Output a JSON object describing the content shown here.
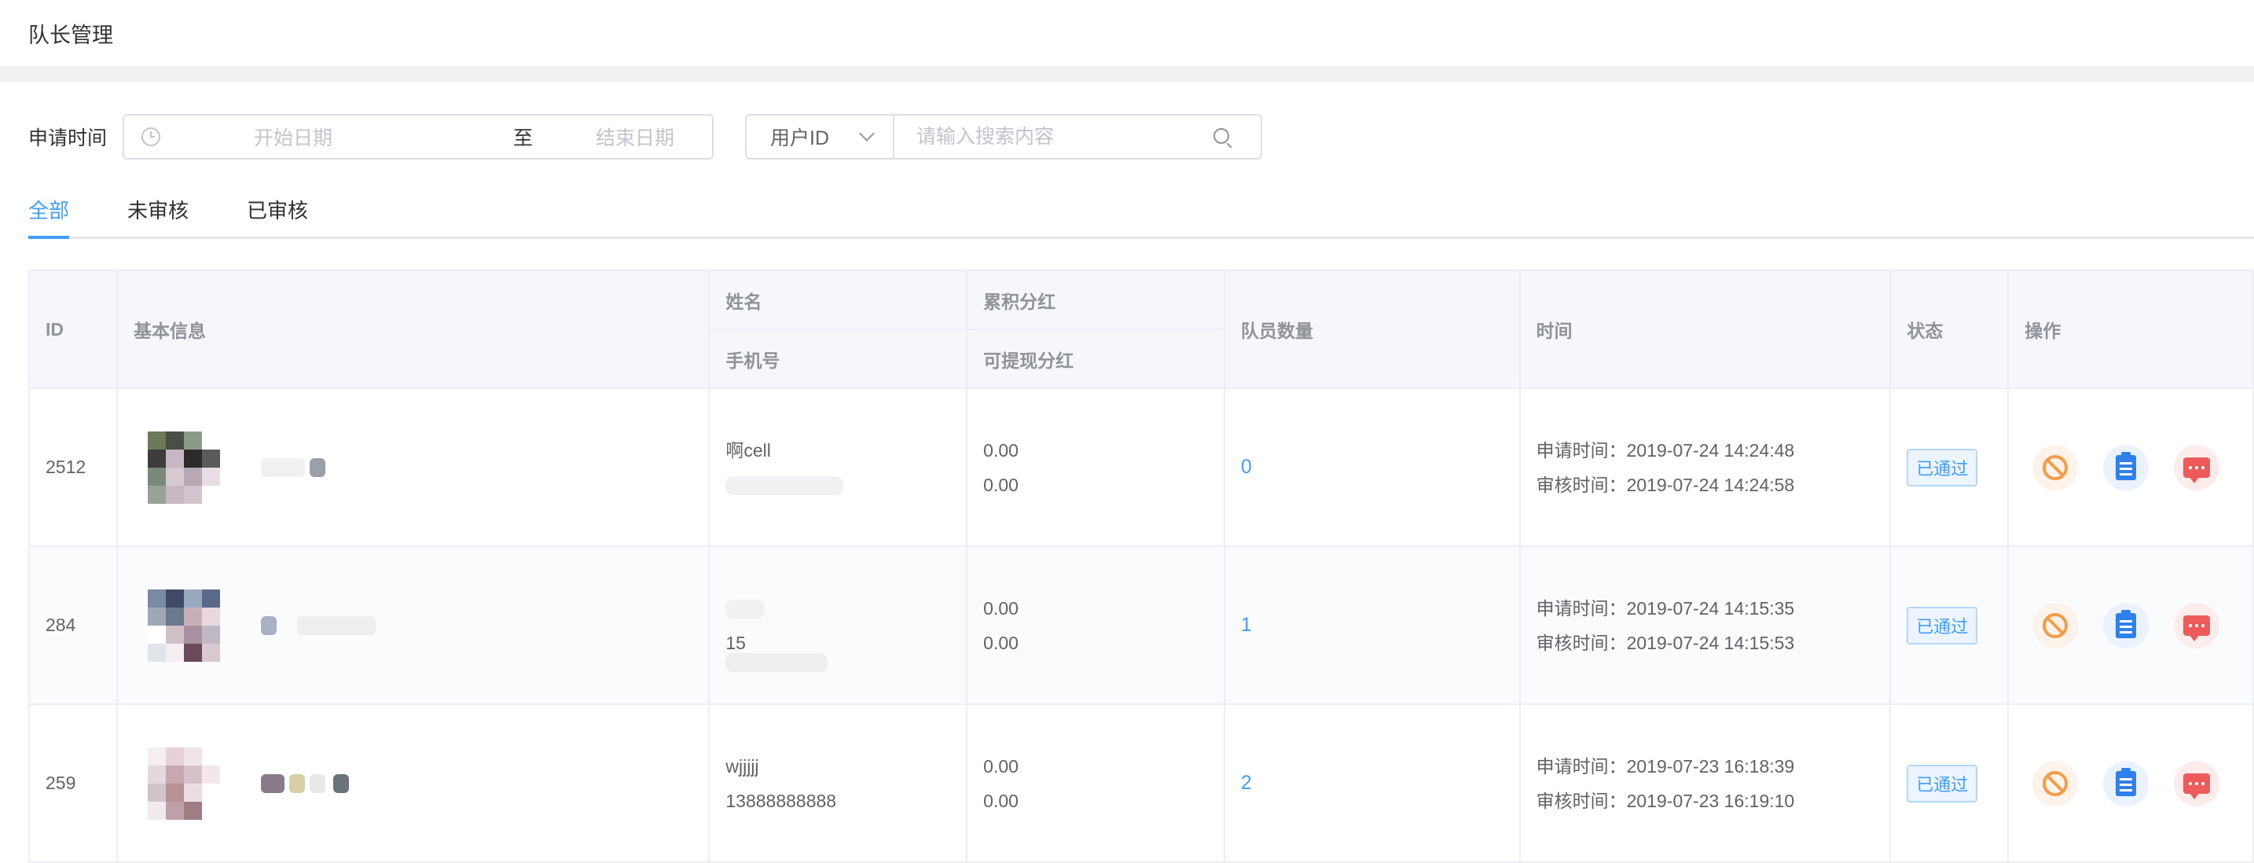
{
  "page_title": "队长管理",
  "filters": {
    "date_label": "申请时间",
    "start_placeholder": "开始日期",
    "range_separator": "至",
    "end_placeholder": "结束日期",
    "search_field_selected": "用户ID",
    "search_placeholder": "请输入搜索内容"
  },
  "tabs": [
    {
      "label": "全部",
      "active": true
    },
    {
      "label": "未审核",
      "active": false
    },
    {
      "label": "已审核",
      "active": false
    }
  ],
  "table": {
    "headers": {
      "id": "ID",
      "basic_info": "基本信息",
      "name": "姓名",
      "phone": "手机号",
      "total_dividend": "累积分红",
      "withdrawable_dividend": "可提现分红",
      "team_count": "队员数量",
      "time": "时间",
      "status": "状态",
      "actions": "操作"
    },
    "rows": [
      {
        "id": "2512",
        "name": "啊cell",
        "phone": "",
        "total_dividend": "0.00",
        "withdrawable_dividend": "0.00",
        "team_count": "0",
        "apply_time": "申请时间：2019-07-24 14:24:48",
        "review_time": "审核时间：2019-07-24 14:24:58",
        "status": "已通过"
      },
      {
        "id": "284",
        "name": "",
        "phone": "15",
        "total_dividend": "0.00",
        "withdrawable_dividend": "0.00",
        "team_count": "1",
        "apply_time": "申请时间：2019-07-24 14:15:35",
        "review_time": "审核时间：2019-07-24 14:15:53",
        "status": "已通过"
      },
      {
        "id": "259",
        "name": "wjjjjj",
        "phone": "13888888888",
        "total_dividend": "0.00",
        "withdrawable_dividend": "0.00",
        "team_count": "2",
        "apply_time": "申请时间：2019-07-23 16:18:39",
        "review_time": "审核时间：2019-07-23 16:19:10",
        "status": "已通过"
      }
    ]
  },
  "icons": {
    "ban": "ban-icon",
    "detail": "clipboard-icon",
    "message": "message-icon",
    "date": "clock-icon",
    "search": "search-icon",
    "dropdown": "chevron-down-icon"
  },
  "colors": {
    "accent": "#409eff",
    "ban": "#f39c4a",
    "detail": "#2f80ed",
    "message": "#ef5b5b"
  }
}
